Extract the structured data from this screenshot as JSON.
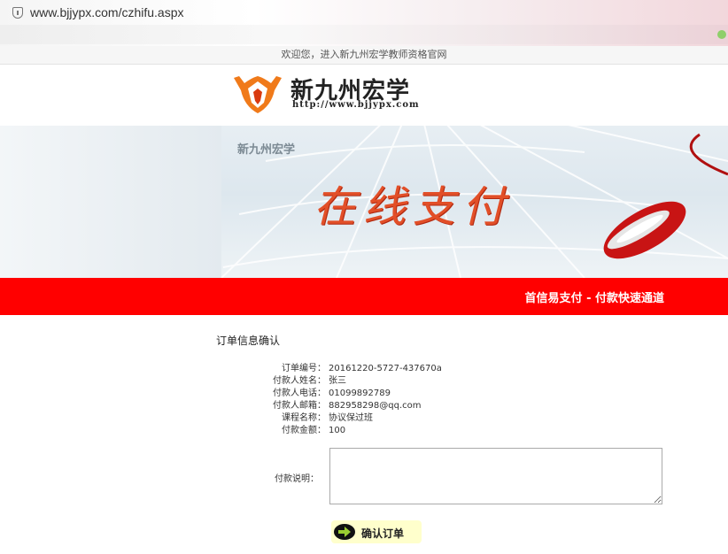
{
  "browser": {
    "url": "www.bjjypx.com/czhifu.aspx"
  },
  "header": {
    "welcome": "欢迎您，进入新九州宏学教师资格官网"
  },
  "logo": {
    "brand": "新九州宏学",
    "site": "http://www.bjjypx.com"
  },
  "banner": {
    "small_title": "新九州宏学",
    "big_title": "在线支付"
  },
  "redbar": {
    "slogan": "首信易支付 - 付款快速通道"
  },
  "order": {
    "title": "订单信息确认",
    "rows": [
      {
        "label": "订单编号：",
        "value": "20161220-5727-437670a"
      },
      {
        "label": "付款人姓名：",
        "value": "张三"
      },
      {
        "label": "付款人电话：",
        "value": "01099892789"
      },
      {
        "label": "付款人邮箱：",
        "value": "882958298@qq.com"
      },
      {
        "label": "课程名称：",
        "value": "协议保过班"
      },
      {
        "label": "付款金额：",
        "value": "100"
      }
    ],
    "note_label": "付款说明：",
    "note_value": "",
    "confirm_label": "确认订单"
  },
  "colors": {
    "red_bar": "#ff0000",
    "banner_text": "#e24f28",
    "logo_orange": "#f07a1a",
    "confirm_bg": "#ffffcc"
  }
}
